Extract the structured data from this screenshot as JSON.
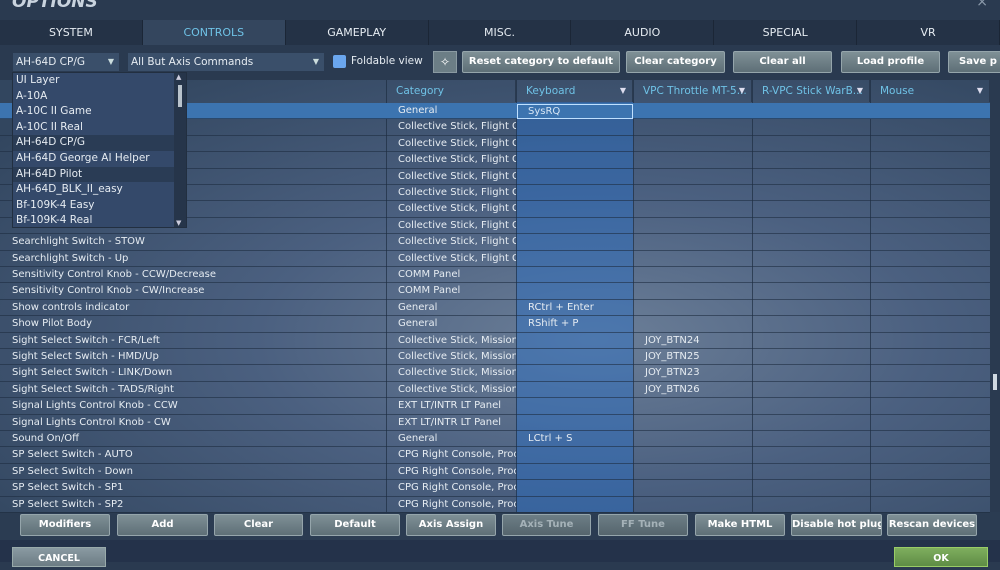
{
  "window": {
    "title": "OPTIONS",
    "close_icon": "×"
  },
  "tabs": [
    "SYSTEM",
    "CONTROLS",
    "GAMEPLAY",
    "MISC.",
    "AUDIO",
    "SPECIAL",
    "VR"
  ],
  "toolbar": {
    "aircraft_select": "AH-64D CP/G",
    "filter_select": "All But Axis Commands",
    "foldable_label": "Foldable view",
    "foldable_checked": true,
    "buttons": [
      "Reset category to default",
      "Clear category",
      "Clear all",
      "Load profile",
      "Save p"
    ]
  },
  "dropdown": {
    "items": [
      "UI Layer",
      "A-10A",
      "A-10C II Game",
      "A-10C II Real",
      "AH-64D CP/G",
      "AH-64D George AI Helper",
      "AH-64D Pilot",
      "AH-64D_BLK_II_easy",
      "Bf-109K-4 Easy",
      "Bf-109K-4 Real"
    ]
  },
  "columns": [
    "Category",
    "Keyboard",
    "VPC Throttle MT-5...",
    "R-VPC Stick WarB...",
    "Mouse"
  ],
  "rows": [
    [
      "",
      "General",
      "SysRQ",
      "",
      ""
    ],
    [
      "",
      "Collective Stick, Flight Gri",
      "",
      "",
      ""
    ],
    [
      "",
      "Collective Stick, Flight Gri",
      "",
      "",
      ""
    ],
    [
      "",
      "Collective Stick, Flight Gri",
      "",
      "",
      ""
    ],
    [
      "",
      "Collective Stick, Flight Gri",
      "",
      "",
      ""
    ],
    [
      "",
      "Collective Stick, Flight Gri",
      "",
      "",
      ""
    ],
    [
      "",
      "Collective Stick, Flight Gri",
      "",
      "",
      ""
    ],
    [
      "",
      "Collective Stick, Flight Gri",
      "",
      "",
      ""
    ],
    [
      "Searchlight Switch - STOW",
      "Collective Stick, Flight Gri",
      "",
      "",
      ""
    ],
    [
      "Searchlight Switch - Up",
      "Collective Stick, Flight Gri",
      "",
      "",
      ""
    ],
    [
      "Sensitivity Control Knob - CCW/Decrease",
      "COMM Panel",
      "",
      "",
      ""
    ],
    [
      "Sensitivity Control Knob - CW/Increase",
      "COMM Panel",
      "",
      "",
      ""
    ],
    [
      "Show controls indicator",
      "General",
      "RCtrl + Enter",
      "",
      ""
    ],
    [
      "Show Pilot Body",
      "General",
      "RShift + P",
      "",
      ""
    ],
    [
      "Sight Select Switch - FCR/Left",
      "Collective Stick, Mission G",
      "",
      "JOY_BTN24",
      ""
    ],
    [
      "Sight Select Switch - HMD/Up",
      "Collective Stick, Mission G",
      "",
      "JOY_BTN25",
      ""
    ],
    [
      "Sight Select Switch - LINK/Down",
      "Collective Stick, Mission G",
      "",
      "JOY_BTN23",
      ""
    ],
    [
      "Sight Select Switch - TADS/Right",
      "Collective Stick, Mission G",
      "",
      "JOY_BTN26",
      ""
    ],
    [
      "Signal Lights Control Knob - CCW",
      "EXT LT/INTR LT Panel",
      "",
      "",
      ""
    ],
    [
      "Signal Lights Control Knob - CW",
      "EXT LT/INTR LT Panel",
      "",
      "",
      ""
    ],
    [
      "Sound On/Off",
      "General",
      "LCtrl + S",
      "",
      ""
    ],
    [
      "SP Select Switch - AUTO",
      "CPG Right Console, Proces",
      "",
      "",
      ""
    ],
    [
      "SP Select Switch - Down",
      "CPG Right Console, Proces",
      "",
      "",
      ""
    ],
    [
      "SP Select Switch - SP1",
      "CPG Right Console, Proces",
      "",
      "",
      ""
    ],
    [
      "SP Select Switch - SP2",
      "CPG Right Console, Proces",
      "",
      "",
      ""
    ]
  ],
  "bottom_buttons": [
    "Modifiers",
    "Add",
    "Clear",
    "Default",
    "Axis Assign",
    "Axis Tune",
    "FF Tune",
    "Make HTML",
    "Disable hot plug",
    "Rescan devices"
  ],
  "footer": {
    "cancel": "CANCEL",
    "ok": "OK"
  }
}
